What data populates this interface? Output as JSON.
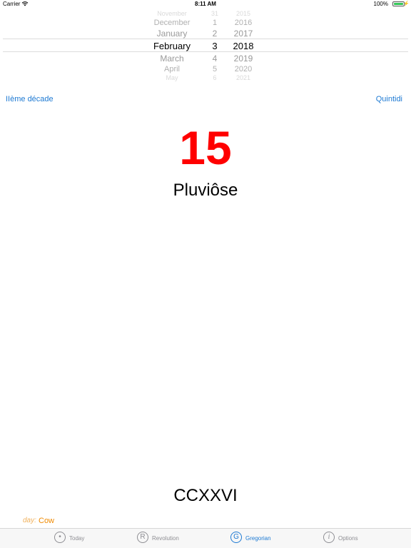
{
  "status_bar": {
    "carrier": "Carrier",
    "time": "8:11 AM",
    "battery": "100%"
  },
  "picker": {
    "rows": [
      {
        "month": "November",
        "day": "31",
        "year": "2015"
      },
      {
        "month": "December",
        "day": "1",
        "year": "2016"
      },
      {
        "month": "January",
        "day": "2",
        "year": "2017"
      },
      {
        "month": "February",
        "day": "3",
        "year": "2018"
      },
      {
        "month": "March",
        "day": "4",
        "year": "2019"
      },
      {
        "month": "April",
        "day": "5",
        "year": "2020"
      },
      {
        "month": "May",
        "day": "6",
        "year": "2021"
      }
    ]
  },
  "header": {
    "decade": "IIème décade",
    "weekday": "Quintidi"
  },
  "main": {
    "day": "15",
    "month": "Pluviôse",
    "year": "CCXXVI"
  },
  "day_info": {
    "caption": "day:",
    "value": "Cow"
  },
  "tabs": [
    {
      "label": "Today",
      "icon": "today-icon",
      "glyph": "•"
    },
    {
      "label": "Revolution",
      "icon": "revolution-icon",
      "glyph": "R"
    },
    {
      "label": "Gregorian",
      "icon": "gregorian-icon",
      "glyph": "G"
    },
    {
      "label": "Options",
      "icon": "info-icon",
      "glyph": "i"
    }
  ],
  "colors": {
    "accent": "#1e7ad3",
    "day_number": "#ff0000",
    "day_label": "#f08a00"
  }
}
